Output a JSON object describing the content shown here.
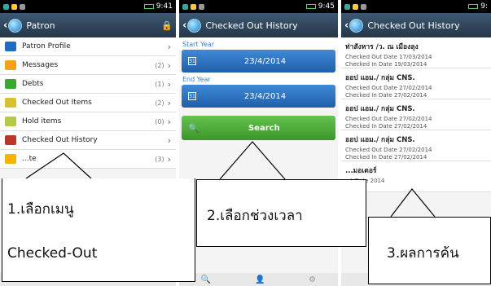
{
  "status_bars": {
    "p1_time": "9:41",
    "p2_time": "9:45",
    "p3_time": "9:"
  },
  "screen1": {
    "title": "Patron",
    "lock_icon": "lock-icon",
    "items": [
      {
        "label": "Patron Profile",
        "count": "",
        "icon_color": "#1e6cc4"
      },
      {
        "label": "Messages",
        "count": "(2)",
        "icon_color": "#f5a21a"
      },
      {
        "label": "Debts",
        "count": "(1)",
        "icon_color": "#3aa836"
      },
      {
        "label": "Checked Out Items",
        "count": "(2)",
        "icon_color": "#d8c030"
      },
      {
        "label": "Hold items",
        "count": "(0)",
        "icon_color": "#b5c84a"
      },
      {
        "label": "Checked Out History",
        "count": "",
        "icon_color": "#c0352b"
      },
      {
        "label": "...te",
        "count": "(3)",
        "icon_color": "#f4b400"
      }
    ]
  },
  "screen2": {
    "title": "Checked Out History",
    "start_label": "Start Year",
    "start_date": "23/4/2014",
    "end_label": "End Year",
    "end_date": "23/4/2014",
    "search_label": "Search"
  },
  "screen3": {
    "title": "Checked Out History",
    "entries": [
      {
        "title": "ท่าสังหาร /ว. ณ เมืองลุง",
        "out_label": "Checked Out Date",
        "out_date": "17/03/2014",
        "in_label": "Checked In Date",
        "in_date": "19/03/2014"
      },
      {
        "title": "ออป แอม./ กลุ่ม CNS.",
        "out_label": "Checked Out Date",
        "out_date": "27/02/2014",
        "in_label": "Checked In Date",
        "in_date": "27/02/2014"
      },
      {
        "title": "ออป แอม./ กลุ่ม CNS.",
        "out_label": "Checked Out Date",
        "out_date": "27/02/2014",
        "in_label": "Checked In Date",
        "in_date": "27/02/2014"
      },
      {
        "title": "ออป แอม./ กลุ่ม CNS.",
        "out_label": "Checked Out Date",
        "out_date": "27/02/2014",
        "in_label": "Checked In Date",
        "in_date": "27/02/2014"
      },
      {
        "title": "...มอเตอร์",
        "out_label": "...t Date",
        "out_date": "2014",
        "in_label": "",
        "in_date": ""
      }
    ]
  },
  "callouts": {
    "c1_line1": "1.เลือกเมนู",
    "c1_line2": "Checked-Out",
    "c2": "2.เลือกช่วงเวลา",
    "c3": "3.ผลการค้น"
  }
}
